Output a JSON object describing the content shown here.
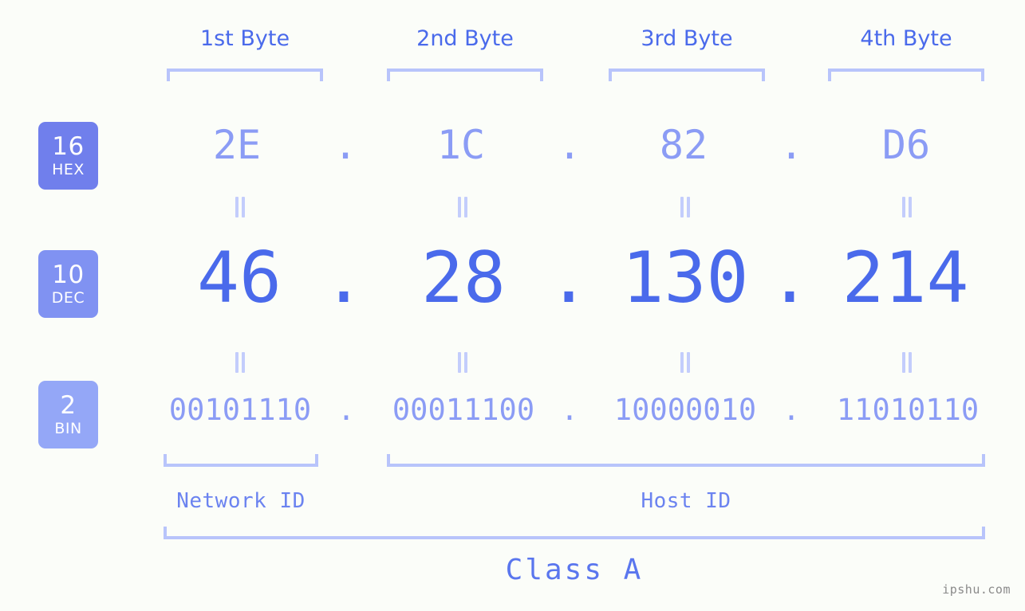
{
  "diagram": {
    "byte_headers": [
      "1st Byte",
      "2nd Byte",
      "3rd Byte",
      "4th Byte"
    ],
    "rows": [
      {
        "base": "16",
        "base_label": "HEX",
        "values": [
          "2E",
          "1C",
          "82",
          "D6"
        ],
        "separator": "."
      },
      {
        "base": "10",
        "base_label": "DEC",
        "values": [
          "46",
          "28",
          "130",
          "214"
        ],
        "separator": "."
      },
      {
        "base": "2",
        "base_label": "BIN",
        "values": [
          "00101110",
          "00011100",
          "10000010",
          "11010110"
        ],
        "separator": "."
      }
    ],
    "equals_symbol": "=",
    "segments": {
      "network_id": "Network ID",
      "host_id": "Host ID"
    },
    "class_label": "Class A",
    "watermark": "ipshu.com",
    "colors": {
      "background": "#fbfdf9",
      "accent_strong": "#4a6aeb",
      "accent_light": "#8b9cf5",
      "bracket": "#b8c4fb",
      "badge_hex": "#707fec",
      "badge_dec": "#8092f2",
      "badge_bin": "#94a7f7",
      "watermark": "#8a8a8a"
    }
  }
}
